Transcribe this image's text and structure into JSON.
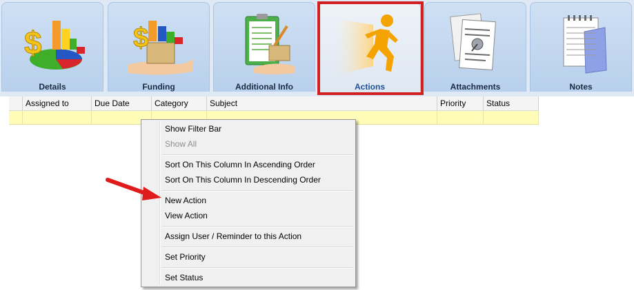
{
  "tabs": [
    {
      "label": "Details",
      "icon": "financial-chart-icon"
    },
    {
      "label": "Funding",
      "icon": "money-box-icon"
    },
    {
      "label": "Additional Info",
      "icon": "clipboard-icon"
    },
    {
      "label": "Actions",
      "icon": "running-man-icon"
    },
    {
      "label": "Attachments",
      "icon": "documents-pin-icon"
    },
    {
      "label": "Notes",
      "icon": "notepad-icon"
    }
  ],
  "grid": {
    "columns": [
      "",
      "Assigned to",
      "Due Date",
      "Category",
      "Subject",
      "Priority",
      "Status"
    ]
  },
  "menu": {
    "items": [
      {
        "label": "Show Filter Bar"
      },
      {
        "label": "Show All",
        "disabled": true
      },
      {
        "label": "Sort On This Column In Ascending Order"
      },
      {
        "label": "Sort On This Column In Descending Order"
      },
      {
        "label": "New Action"
      },
      {
        "label": "View Action"
      },
      {
        "label": "Assign User / Reminder to this Action"
      },
      {
        "label": "Set Priority"
      },
      {
        "label": "Set Status"
      }
    ]
  },
  "colors": {
    "highlight": "#d21f1f",
    "new_row": "#fffcb7",
    "tab_bg": "#cfe0f3"
  }
}
